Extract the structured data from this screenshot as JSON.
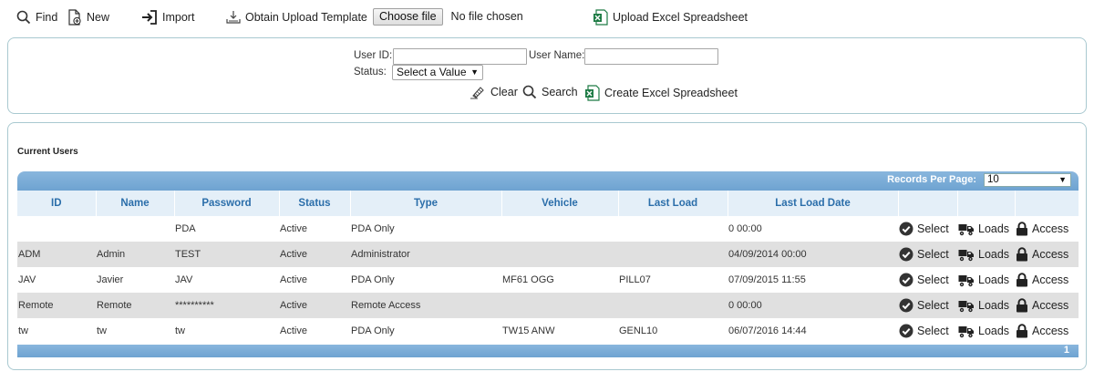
{
  "toolbar": {
    "find_label": "Find",
    "new_label": "New",
    "import_label": "Import",
    "obtain_template_label": "Obtain Upload Template",
    "choose_file_label": "Choose file",
    "no_file_text": "No file chosen",
    "upload_excel_label": "Upload Excel Spreadsheet"
  },
  "search": {
    "user_id_label": "User ID:",
    "user_id_value": "",
    "user_name_label": "User Name:",
    "user_name_value": "",
    "status_label": "Status:",
    "status_value": "Select a Value",
    "clear_label": "Clear",
    "search_label": "Search",
    "create_excel_label": "Create Excel Spreadsheet"
  },
  "users": {
    "title": "Current Users",
    "records_per_page_label": "Records Per Page:",
    "records_per_page_value": "10",
    "columns": [
      "ID",
      "Name",
      "Password",
      "Status",
      "Type",
      "Vehicle",
      "Last Load",
      "Last Load Date",
      "",
      "",
      ""
    ],
    "rows": [
      {
        "id": "",
        "name": "",
        "password": "PDA",
        "status": "Active",
        "type": "PDA Only",
        "vehicle": "",
        "last_load": "",
        "last_load_date": "0 00:00"
      },
      {
        "id": "ADM",
        "name": "Admin",
        "password": "TEST",
        "status": "Active",
        "type": "Administrator",
        "vehicle": "",
        "last_load": "",
        "last_load_date": "04/09/2014 00:00"
      },
      {
        "id": "JAV",
        "name": "Javier",
        "password": "JAV",
        "status": "Active",
        "type": "PDA Only",
        "vehicle": "MF61 OGG",
        "last_load": "PILL07",
        "last_load_date": "07/09/2015 11:55"
      },
      {
        "id": "Remote",
        "name": "Remote",
        "password": "**********",
        "status": "Active",
        "type": "Remote Access",
        "vehicle": "",
        "last_load": "",
        "last_load_date": "0 00:00"
      },
      {
        "id": "tw",
        "name": "tw",
        "password": "tw",
        "status": "Active",
        "type": "PDA Only",
        "vehicle": "TW15 ANW",
        "last_load": "GENL10",
        "last_load_date": "06/07/2016 14:44"
      }
    ],
    "row_actions": {
      "select_label": "Select",
      "loads_label": "Loads",
      "access_label": "Access"
    },
    "page_number": "1"
  },
  "icons": {
    "find": "search-icon",
    "new": "new-document-icon",
    "import": "import-icon",
    "obtain_template": "download-template-icon",
    "upload_excel": "excel-icon",
    "clear": "eraser-icon",
    "search": "search-icon",
    "create_excel": "excel-icon",
    "select": "check-circle-icon",
    "loads": "truck-icon",
    "access": "padlock-icon"
  },
  "colors": {
    "grid_header": "#6ea3d1",
    "column_header_bg": "#e4eff8",
    "column_header_text": "#2b6eaa",
    "panel_border": "#a9c9d0",
    "excel_green": "#1e7b45"
  }
}
